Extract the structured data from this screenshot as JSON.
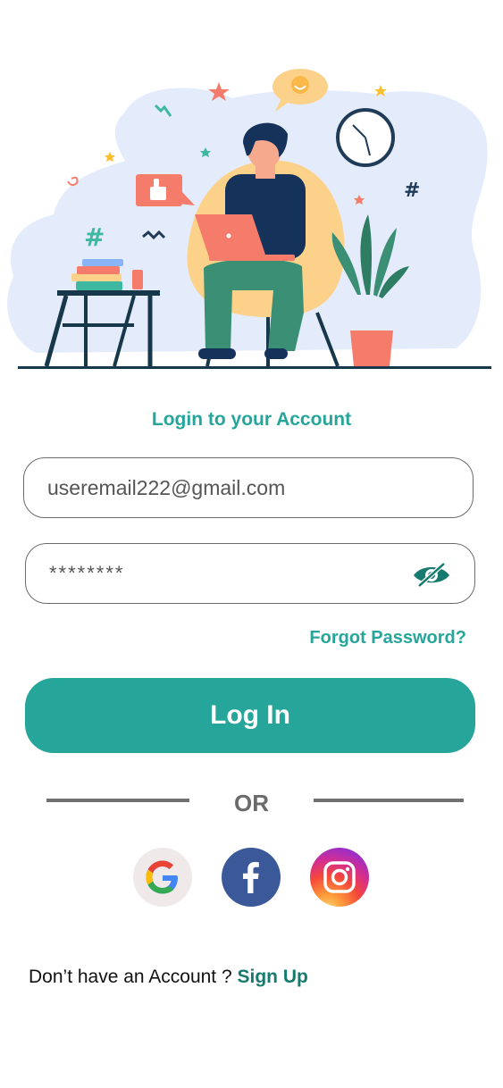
{
  "login": {
    "title": "Login to your Account",
    "email_value": "useremail222@gmail.com",
    "password_value": "********",
    "forgot_label": "Forgot Password?",
    "login_button_label": "Log In",
    "or_label": "OR",
    "signup_prompt": "Don’t have an Account ?",
    "signup_link": "Sign Up"
  },
  "social": {
    "google_letter": "G",
    "facebook_letter": "f"
  },
  "colors": {
    "accent": "#26a69a",
    "accent_dark": "#167b6e",
    "border": "#6b6b6b",
    "facebook": "#3b5998"
  },
  "icons": [
    "password-visibility-icon",
    "google-icon",
    "facebook-icon",
    "instagram-icon"
  ]
}
